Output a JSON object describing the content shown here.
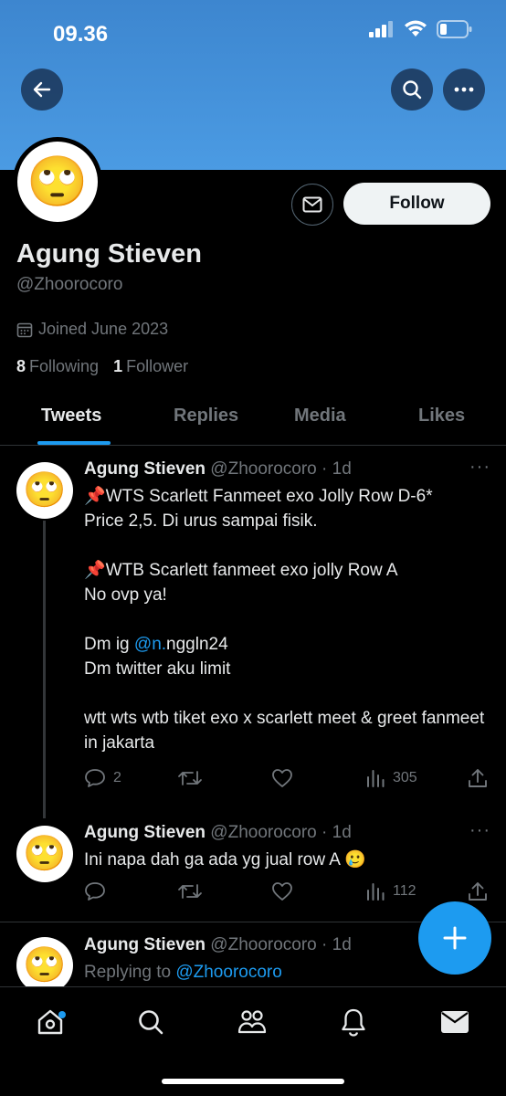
{
  "status_bar": {
    "time": "09.36"
  },
  "profile": {
    "display_name": "Agung Stieven",
    "handle": "@Zhoorocoro",
    "joined": "Joined June 2023",
    "following_count": "8",
    "following_label": "Following",
    "follower_count": "1",
    "follower_label": "Follower",
    "follow_label": "Follow",
    "avatar_emoji": "🙄"
  },
  "tabs": [
    {
      "label": "Tweets",
      "active": true
    },
    {
      "label": "Replies",
      "active": false
    },
    {
      "label": "Media",
      "active": false
    },
    {
      "label": "Likes",
      "active": false
    }
  ],
  "tweets": [
    {
      "name": "Agung Stieven",
      "meta": "@Zhoorocoro · 1d",
      "avatar": "🙄",
      "text_a": "📌WTS Scarlett Fanmeet exo Jolly Row D-6*\nPrice 2,5. Di urus sampai fisik.\n\n📌WTB Scarlett fanmeet exo jolly Row A\nNo ovp ya!\n\nDm ig ",
      "mention": "@n.",
      "text_b": "nggln24\nDm twitter aku limit\n\nwtt wts wtb tiket exo x scarlett meet & greet fanmeet in jakarta",
      "replies": "2",
      "views": "305"
    },
    {
      "name": "Agung Stieven",
      "meta": "@Zhoorocoro · 1d",
      "avatar": "🙄",
      "text": "Ini napa dah ga ada yg jual row A 🥲",
      "views": "112"
    },
    {
      "name": "Agung Stieven",
      "meta": "@Zhoorocoro · 1d",
      "avatar": "🙄",
      "replying_prefix": "Replying to ",
      "replying_to": "@Zhoorocoro"
    }
  ],
  "colors": {
    "accent": "#1d9bf0",
    "banner": "#4b9be3",
    "muted": "#71767b"
  },
  "icons": [
    "back-arrow-icon",
    "search-icon",
    "more-icon",
    "mail-icon",
    "calendar-icon",
    "reply-icon",
    "retweet-icon",
    "like-icon",
    "views-icon",
    "share-icon",
    "compose-icon",
    "home-icon",
    "communities-icon",
    "bell-icon"
  ]
}
